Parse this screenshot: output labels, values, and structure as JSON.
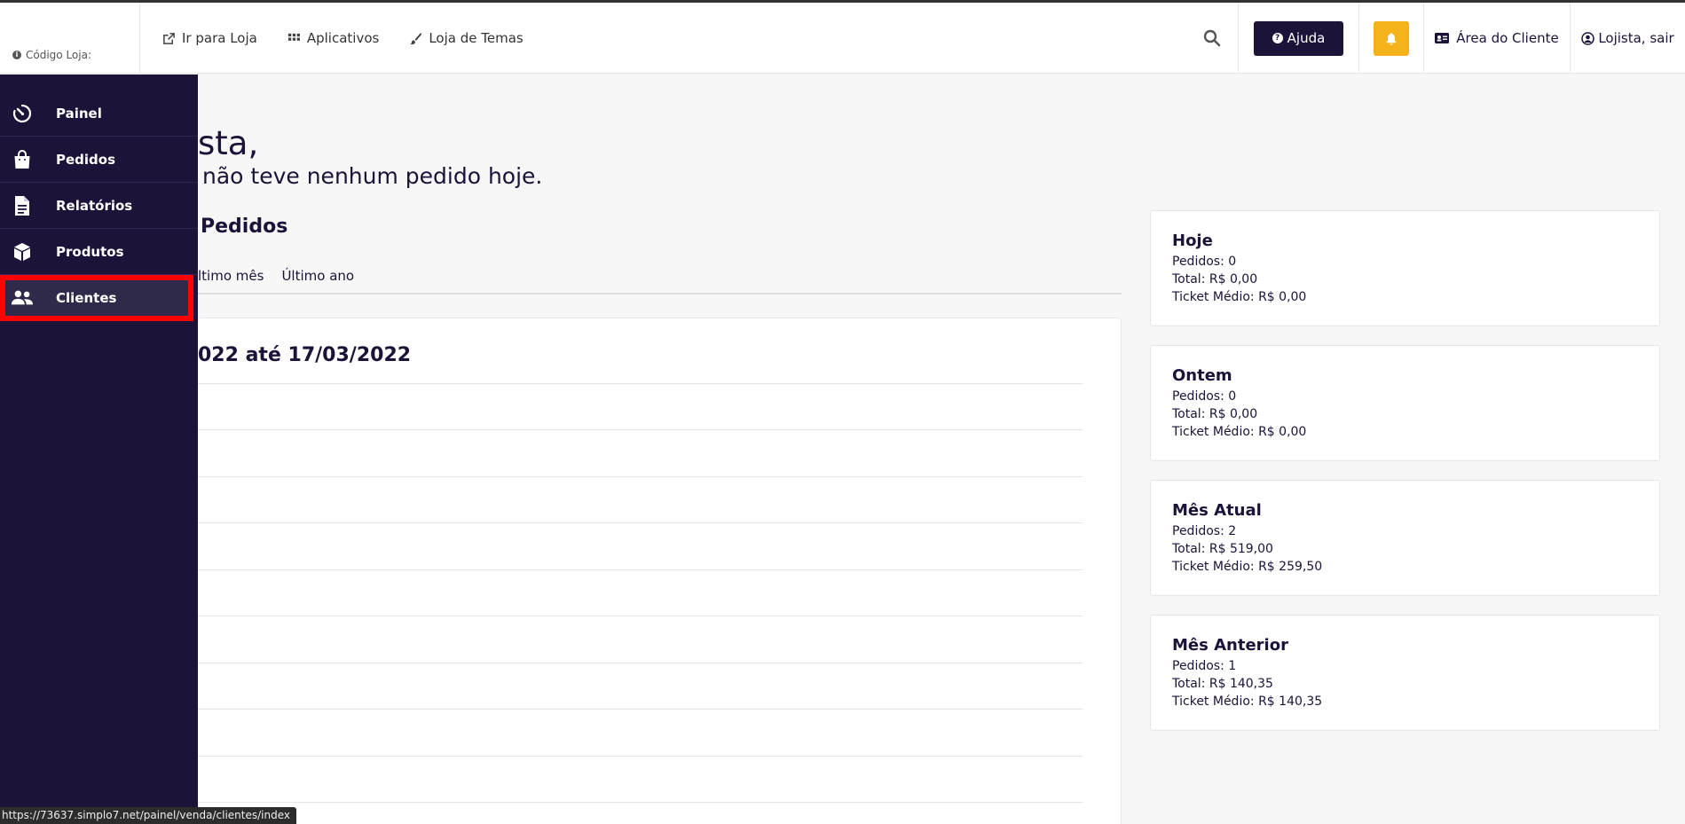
{
  "topbar": {
    "store_code_label": "Código Loja:",
    "links": [
      {
        "label": "Ir para Loja",
        "icon": "external-link-icon"
      },
      {
        "label": "Aplicativos",
        "icon": "grid-icon"
      },
      {
        "label": "Loja de Temas",
        "icon": "brush-icon"
      }
    ],
    "help_label": "Ajuda",
    "client_area_label": "Área do Cliente",
    "user_label": "Lojista, sair"
  },
  "sidebar": {
    "items": [
      {
        "label": "Painel",
        "icon": "dashboard-icon"
      },
      {
        "label": "Pedidos",
        "icon": "shopping-bag-icon"
      },
      {
        "label": "Relatórios",
        "icon": "document-icon"
      },
      {
        "label": "Produtos",
        "icon": "box-icon"
      },
      {
        "label": "Clientes",
        "icon": "users-icon",
        "active": true
      }
    ]
  },
  "main": {
    "greeting": "sta,",
    "subtitle": "não teve nenhum pedido hoje.",
    "section_title": "Pedidos",
    "filters": [
      "ltimo mês",
      "Último ano"
    ],
    "date_range": "022 até 17/03/2022"
  },
  "cards": [
    {
      "title": "Hoje",
      "pedidos": "Pedidos: 0",
      "total": "Total: R$ 0,00",
      "ticket": "Ticket Médio: R$ 0,00"
    },
    {
      "title": "Ontem",
      "pedidos": "Pedidos: 0",
      "total": "Total: R$ 0,00",
      "ticket": "Ticket Médio: R$ 0,00"
    },
    {
      "title": "Mês Atual",
      "pedidos": "Pedidos: 2",
      "total": "Total: R$ 519,00",
      "ticket": "Ticket Médio: R$ 259,50"
    },
    {
      "title": "Mês Anterior",
      "pedidos": "Pedidos: 1",
      "total": "Total: R$ 140,35",
      "ticket": "Ticket Médio: R$ 140,35"
    }
  ],
  "status_url": "https://73637.simplo7.net/painel/venda/clientes/index",
  "colors": {
    "primary": "#1d1238",
    "bell": "#f5b21b",
    "highlight": "#ff0000"
  }
}
